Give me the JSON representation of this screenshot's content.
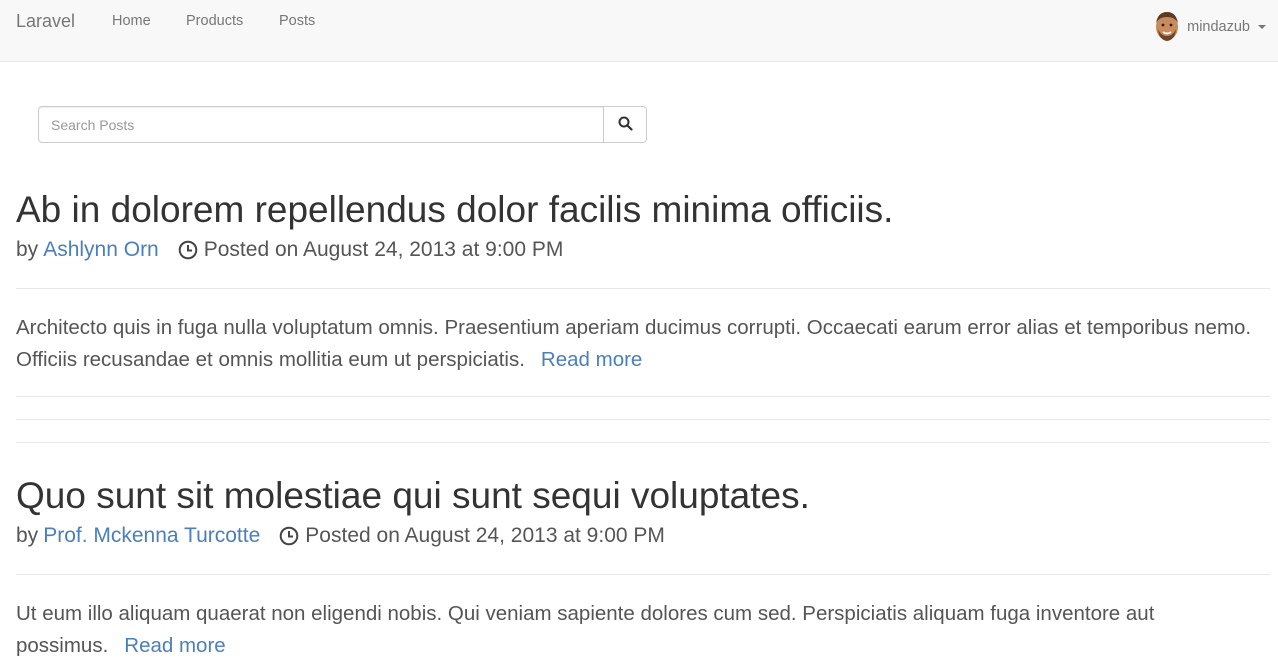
{
  "navbar": {
    "brand": "Laravel",
    "links": [
      "Home",
      "Products",
      "Posts"
    ],
    "user": {
      "name": "mindazub",
      "avatar_icon": "avatar-cartoon-icon"
    }
  },
  "search": {
    "placeholder": "Search Posts",
    "value": "",
    "button_icon": "search-icon"
  },
  "posts": [
    {
      "title": "Ab in dolorem repellendus dolor facilis minima officiis.",
      "by": "by",
      "author": "Ashlynn Orn",
      "posted": "Posted on August 24, 2013 at 9:00 PM",
      "excerpt": "Architecto quis in fuga nulla voluptatum omnis. Praesentium aperiam ducimus corrupti. Occaecati earum error alias et temporibus nemo. Officiis recusandae et omnis mollitia eum ut perspiciatis.",
      "read_more": "Read more"
    },
    {
      "title": "Quo sunt sit molestiae qui sunt sequi voluptates.",
      "by": "by",
      "author": "Prof. Mckenna Turcotte",
      "posted": "Posted on August 24, 2013 at 9:00 PM",
      "excerpt": "Ut eum illo aliquam quaerat non eligendi nobis. Qui veniam sapiente dolores cum sed. Perspiciatis aliquam fuga inventore aut possimus.",
      "read_more": "Read more"
    }
  ],
  "colors": {
    "link": "#4a7fbd",
    "navbar_bg": "#f8f8f8",
    "text": "#333333"
  }
}
